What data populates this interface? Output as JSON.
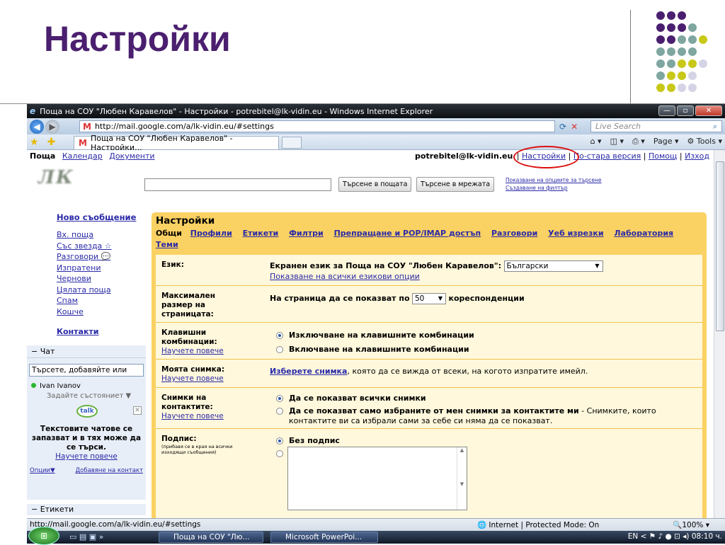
{
  "slide": {
    "title": "Настройки"
  },
  "window": {
    "title": "Поща на СОУ \"Любен Каравелов\" - Настройки - potrebitel@lk-vidin.eu - Windows Internet Explorer",
    "address": "http://mail.google.com/a/lk-vidin.eu/#settings",
    "live_search": "Live Search",
    "tab_title": "Поща на СОУ \"Любен Каравелов\" - Настройки...",
    "page_label": "Page",
    "tools_label": "Tools",
    "status_url": "http://mail.google.com/a/lk-vidin.eu/#settings",
    "status_zone": "Internet | Protected Mode: On",
    "status_zoom": "100%"
  },
  "gmail": {
    "nav": {
      "mail": "Поща",
      "calendar": "Календар",
      "docs": "Документи"
    },
    "account": "potrebitel@lk-vidin.eu",
    "toplinks": [
      "Настройки",
      "По-стара версия",
      "Помощ",
      "Изход"
    ],
    "search_mail_btn": "Търсене в пощата",
    "search_web_btn": "Търсене в мрежата",
    "show_search_options": "Показване на опциите за търсене",
    "create_filter": "Създаване на филтър",
    "logo_text": "ЛК",
    "compose": "Ново съобщение",
    "folders": [
      "Вх. поща",
      "Със звезда ☆",
      "Разговори 💬",
      "Изпратени",
      "Чернови",
      "Цялата поща",
      "Спам",
      "Кошче"
    ],
    "contacts": "Контакти",
    "chat": {
      "header": "−  Чат",
      "search": "Търсете, добавяйте или",
      "user": "Ivan Ivanov",
      "status": "Задайте състояниет ▼",
      "talk": "talk",
      "info": "Текстовите чатове се запазват и в тях може да се търси.",
      "learn_more": "Научете повече",
      "options": "Опции▼",
      "add_contact": "Добавяне на контакт"
    },
    "labels_header": "−  Етикети"
  },
  "settings": {
    "title": "Настройки",
    "tabs": [
      "Общи",
      "Профили",
      "Етикети",
      "Филтри",
      "Препращане и POP/IMAP достъп",
      "Разговори",
      "Уеб изрезки",
      "Лаборатория",
      "Теми"
    ],
    "language": {
      "label": "Език:",
      "text": "Екранен език за Поща на СОУ \"Любен Каравелов\":",
      "value": "Български",
      "link": "Показване на всички езикови опции"
    },
    "page_size": {
      "label": "Максимален размер на страницата:",
      "prefix": "На страница да се показват по",
      "value": "50",
      "suffix": "кореспонденции"
    },
    "shortcuts": {
      "label": "Клавишни комбинации:",
      "learn": "Научете повече",
      "off": "Изключване на клавишните комбинации",
      "on": "Включване на клавишните комбинации"
    },
    "picture": {
      "label": "Моята снимка:",
      "learn": "Научете повече",
      "link": "Изберете снимка",
      "text": ", която да се вижда от всеки, на когото изпратите имейл."
    },
    "contact_pics": {
      "label": "Снимки на контактите:",
      "learn": "Научете повече",
      "all": "Да се показват всички снимки",
      "mine": "Да се показват само избраните от мен снимки за контактите ми",
      "mine_note": " - Снимките, които контактите ви са избрали сами за себе си няма да се показват."
    },
    "signature": {
      "label": "Подпис:",
      "sub": "(прибавя се в края на всички изходящи съобщения)",
      "none": "Без подпис"
    }
  },
  "taskbar": {
    "btn1": "Поща на СОУ \"Лю...",
    "btn2": "Microsoft PowerPoi...",
    "lang": "EN",
    "clock": "08:10 ч."
  },
  "colors": {
    "title": "#4b1f6f",
    "panel": "#fad163",
    "link": "#2a2aa8",
    "dot_purple": "#4b1f6f",
    "dot_teal": "#7fa6a0",
    "dot_yellow": "#c8c818",
    "dot_grey": "#d4d4e6"
  }
}
